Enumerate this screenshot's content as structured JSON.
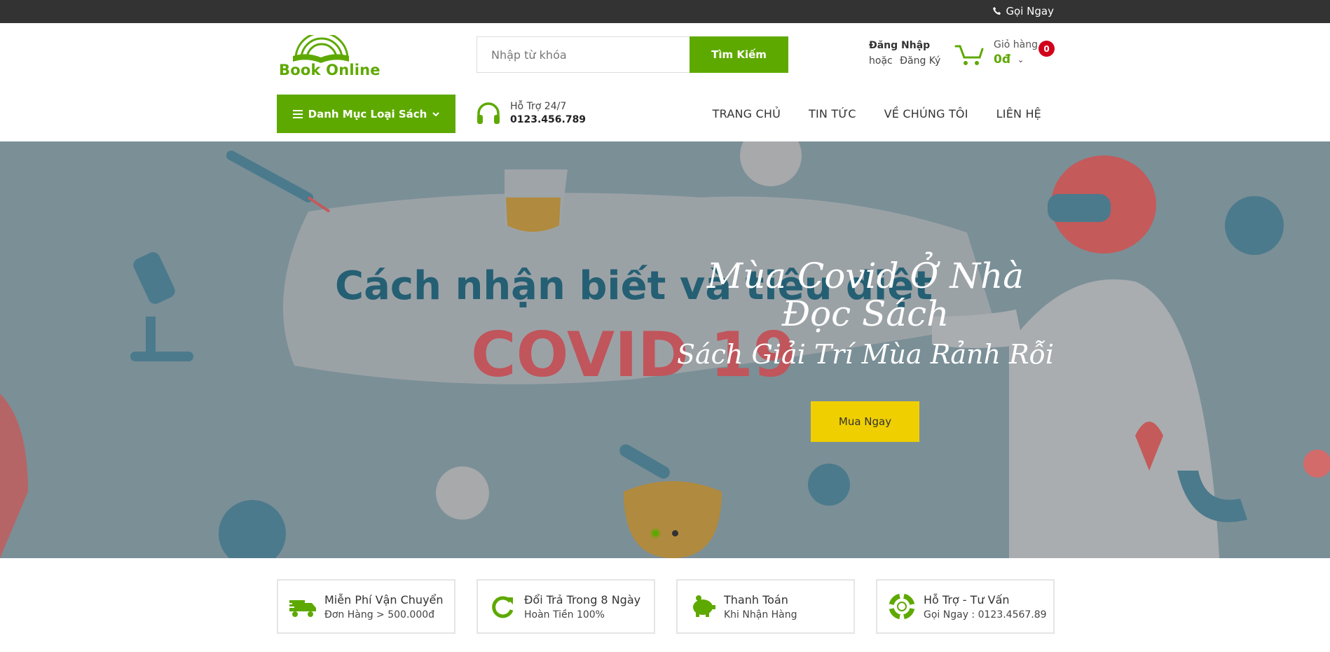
{
  "topbar": {
    "call_label": "Gọi Ngay",
    "icon": "phone-icon"
  },
  "logo": {
    "text": "Book Online",
    "icon": "book-rainbow-icon"
  },
  "search": {
    "placeholder": "Nhập từ khóa",
    "button_label": "Tìm Kiếm"
  },
  "account": {
    "login_label": "Đăng Nhập",
    "or_label": "hoặc",
    "register_label": "Đăng Ký"
  },
  "cart": {
    "label": "Giỏ hàng",
    "total": "0đ",
    "count": "0",
    "icon": "cart-icon"
  },
  "category_button": {
    "label": "Danh Mục Loại Sách"
  },
  "support": {
    "title": "Hỗ Trợ 24/7",
    "phone": "0123.456.789",
    "icon": "headphones-icon"
  },
  "menu": [
    {
      "label": "TRANG CHỦ"
    },
    {
      "label": "TIN TỨC"
    },
    {
      "label": "VỀ CHÚNG TÔI"
    },
    {
      "label": "LIÊN HỆ"
    }
  ],
  "hero": {
    "title": "Mùa Covid Ở Nhà Đọc Sách",
    "subtitle": "Sách Giải Trí Mùa Rảnh Rỗi",
    "button_label": "Mua Ngay",
    "banner_text_1": "Cách nhận biết và tiêu diệt",
    "banner_text_2": "COVID 19"
  },
  "features": [
    {
      "title": "Miễn Phí Vận Chuyển",
      "sub": "Đơn Hàng > 500.000đ",
      "icon": "truck-icon"
    },
    {
      "title": "Đổi Trả Trong 8 Ngày",
      "sub": "Hoàn Tiền 100%",
      "icon": "refresh-icon"
    },
    {
      "title": "Thanh Toán",
      "sub": "Khi Nhận Hàng",
      "icon": "piggy-bank-icon"
    },
    {
      "title": "Hỗ Trợ - Tư Vấn",
      "sub": "Gọi Ngay : 0123.4567.89",
      "icon": "lifebuoy-icon"
    }
  ],
  "colors": {
    "brand_green": "#5ea900",
    "cta_yellow": "#f0cf00",
    "badge_red": "#d0021b",
    "topbar": "#333333"
  }
}
